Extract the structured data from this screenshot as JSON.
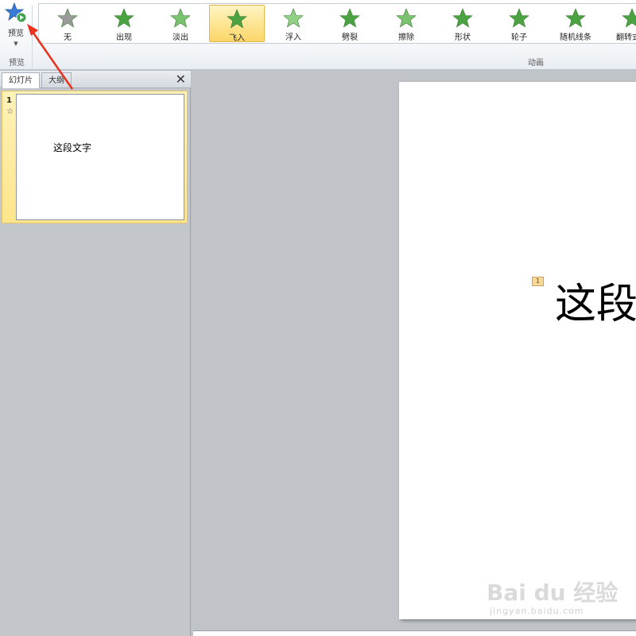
{
  "ribbon": {
    "preview": {
      "label": "预览",
      "group_label": "预览"
    },
    "animation_group_label": "动画",
    "animations": [
      {
        "label": "无",
        "icon": "star-none-icon",
        "color": "#9a9a9a",
        "selected": false
      },
      {
        "label": "出现",
        "icon": "star-appear-icon",
        "color": "#4aa340",
        "selected": false
      },
      {
        "label": "淡出",
        "icon": "star-fade-icon",
        "color": "#79c36e",
        "selected": false
      },
      {
        "label": "飞入",
        "icon": "star-fly-in-icon",
        "color": "#4aa340",
        "selected": true
      },
      {
        "label": "浮入",
        "icon": "star-float-in-icon",
        "color": "#8fd084",
        "selected": false
      },
      {
        "label": "劈裂",
        "icon": "star-split-icon",
        "color": "#4aa340",
        "selected": false
      },
      {
        "label": "擦除",
        "icon": "star-wipe-icon",
        "color": "#79c36e",
        "selected": false
      },
      {
        "label": "形状",
        "icon": "star-shape-icon",
        "color": "#4aa340",
        "selected": false
      },
      {
        "label": "轮子",
        "icon": "star-wheel-icon",
        "color": "#4aa340",
        "selected": false
      },
      {
        "label": "随机线条",
        "icon": "star-random-bars-icon",
        "color": "#4aa340",
        "selected": false
      },
      {
        "label": "翻转式由",
        "icon": "star-flip-icon",
        "color": "#4aa340",
        "selected": false
      }
    ]
  },
  "left_pane": {
    "tabs": [
      {
        "label": "幻灯片",
        "active": true
      },
      {
        "label": "大纲",
        "active": false
      }
    ],
    "close_icon": "close-icon",
    "slides": [
      {
        "number": "1",
        "has_animation_icon": "☆",
        "text": "这段文字"
      }
    ]
  },
  "slide": {
    "anim_tag": "1",
    "text": "这段"
  },
  "watermark": {
    "logo": "Bai du 经验",
    "sub": "jingyan.baidu.com"
  },
  "colors": {
    "selected_bg": "#fcd769",
    "annotation_arrow": "#e8321e",
    "preview_star": "#3a7bd5"
  }
}
